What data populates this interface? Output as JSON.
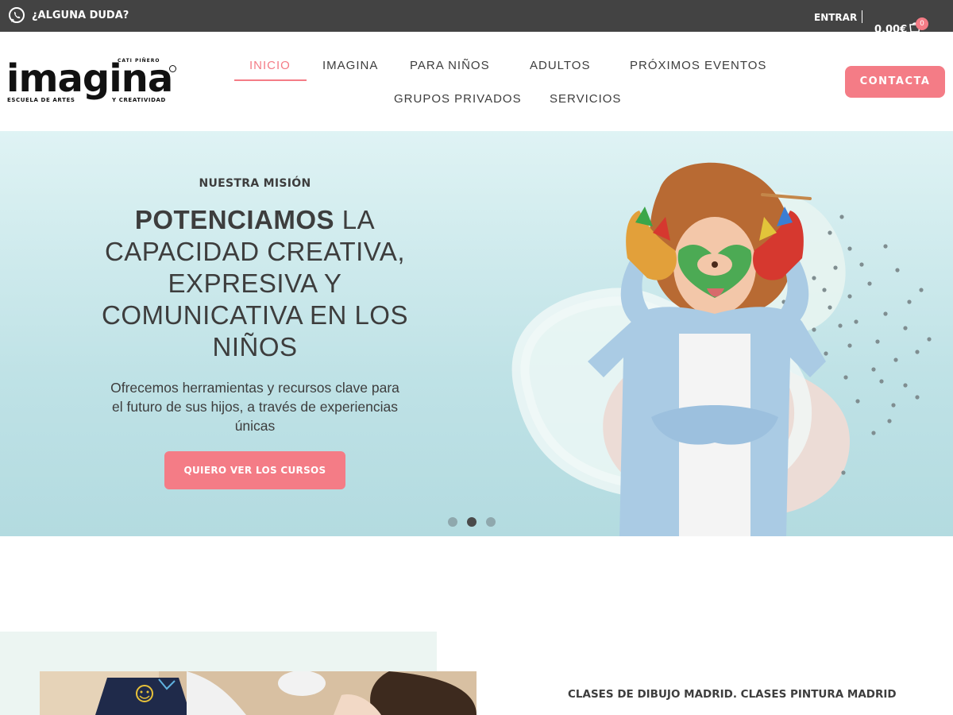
{
  "topbar": {
    "question": "¿ALGUNA DUDA?",
    "login": "ENTRAR",
    "cart_total": "0,00€",
    "cart_count": "0"
  },
  "brand": {
    "wordmark": "imagina",
    "author": "CATI PIÑERO",
    "tagline_left": "ESCUELA DE ARTES",
    "tagline_right": "Y CREATIVIDAD"
  },
  "nav": {
    "items": [
      {
        "label": "INICIO",
        "active": true
      },
      {
        "label": "IMAGINA",
        "active": false
      },
      {
        "label": "PARA NIÑOS",
        "active": false
      },
      {
        "label": "ADULTOS",
        "active": false
      },
      {
        "label": "PRÓXIMOS EVENTOS",
        "active": false
      },
      {
        "label": "GRUPOS PRIVADOS",
        "active": false
      },
      {
        "label": "SERVICIOS",
        "active": false
      }
    ],
    "contact_button": "CONTACTA"
  },
  "hero": {
    "eyebrow": "NUESTRA MISIÓN",
    "headline_bold": "POTENCIAMOS",
    "headline_rest": " LA CAPACIDAD CREATIVA, EXPRESIVA Y COMUNICATIVA EN LOS NIÑOS",
    "description": "Ofrecemos herramientas y recursos clave para el futuro de sus hijos, a través de experiencias únicas",
    "cta": "QUIERO VER LOS CURSOS",
    "slide_count": 3,
    "active_slide": 2
  },
  "section": {
    "heading": "CLASES DE DIBUJO MADRID. CLASES PINTURA MADRID"
  },
  "colors": {
    "accent": "#f47c86",
    "topbar": "#434343",
    "text": "#3d3d3d",
    "hero_bg": "#c9e8eb"
  }
}
